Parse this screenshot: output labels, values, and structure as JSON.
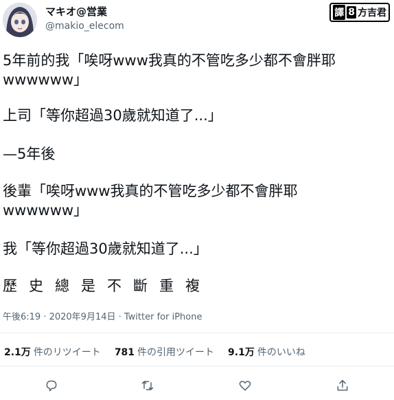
{
  "user": {
    "display_name": "マキオ@営業",
    "handle": "@makio_elecom"
  },
  "badge": {
    "part1": "譯",
    "part2": "8",
    "part3": "方吉君"
  },
  "tweet": {
    "lines": [
      "5年前的我「唉呀www我真的不管吃多少都不會胖耶",
      "wwwwww」",
      "上司「等你超過30歲就知道了...」",
      "—5年後",
      "後輩「唉呀www我真的不管吃多少都不會胖耶",
      "wwwwww」",
      "我「等你超過30歲就知道了...」",
      "歷史總是不斷重複"
    ]
  },
  "meta": "午後6:19 · 2020年9月14日 · Twitter for iPhone",
  "stats": {
    "retweets_count": "2.1万",
    "retweets_label": "件のリツイート",
    "quotes_count": "781",
    "quotes_label": "件の引用ツイート",
    "likes_count": "9.1万",
    "likes_label": "件のいいね"
  },
  "actions": [
    "reply-icon",
    "retweet-icon",
    "like-icon",
    "share-icon"
  ]
}
